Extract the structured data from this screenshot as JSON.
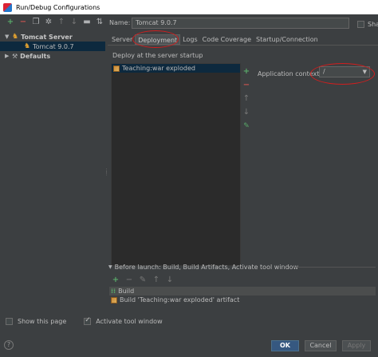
{
  "window": {
    "title": "Run/Debug Configurations"
  },
  "left": {
    "toolbar_icons": [
      "add-icon",
      "remove-icon",
      "copy-icon",
      "settings-icon",
      "move-up-icon",
      "move-down-icon",
      "folder-icon",
      "sort-icon"
    ],
    "tree": [
      {
        "label": "Tomcat Server",
        "expanded": true,
        "bold": true
      },
      {
        "label": "Tomcat 9.0.7",
        "selected": true
      },
      {
        "label": "Defaults",
        "expanded": false,
        "bold": true
      }
    ]
  },
  "config": {
    "name_label": "Name:",
    "name_value": "Tomcat 9.0.7",
    "share_label": "Share",
    "tabs": [
      "Server",
      "Deployment",
      "Logs",
      "Code Coverage",
      "Startup/Connection"
    ],
    "active_tab": "Deployment"
  },
  "deployment": {
    "section_label": "Deploy at the server startup",
    "items": [
      "Teaching:war exploded"
    ],
    "context_label": "Application context:",
    "context_value": "/"
  },
  "before_launch": {
    "header": "Before launch: Build, Build Artifacts, Activate tool window",
    "items": [
      "Build",
      "Build 'Teaching:war exploded' artifact"
    ],
    "show_this_page": "Show this page",
    "activate_tool_window": "Activate tool window"
  },
  "buttons": {
    "ok": "OK",
    "cancel": "Cancel",
    "apply": "Apply"
  },
  "help": "?"
}
